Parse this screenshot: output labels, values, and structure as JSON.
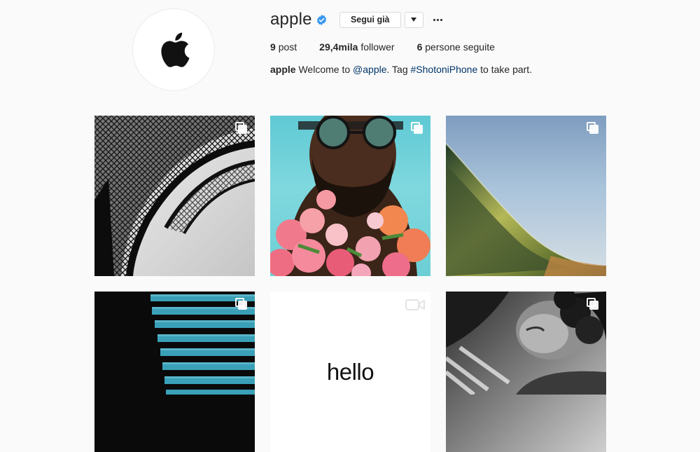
{
  "profile": {
    "username": "apple",
    "follow_button": "Segui già",
    "stats": [
      {
        "count": "9",
        "label": "post"
      },
      {
        "count": "29,4mila",
        "label": "follower"
      },
      {
        "count": "6",
        "label": "persone seguite"
      }
    ],
    "bio": {
      "name": "apple",
      "text1": "Welcome to",
      "mention": "@apple",
      "text2": ". Tag",
      "hashtag": "#ShotoniPhone",
      "text3": "to take part."
    }
  },
  "posts": [
    {
      "type": "multi",
      "subject": "eiffel-tower"
    },
    {
      "type": "multi",
      "subject": "man-with-flowers"
    },
    {
      "type": "multi",
      "subject": "ocean-wave"
    },
    {
      "type": "multi",
      "subject": "blue-stripes"
    },
    {
      "type": "video",
      "subject": "hello",
      "caption": "hello"
    },
    {
      "type": "multi",
      "subject": "bw-portrait"
    }
  ],
  "colors": {
    "background": "#fafafa",
    "verified": "#3897f0",
    "link": "#003569"
  }
}
